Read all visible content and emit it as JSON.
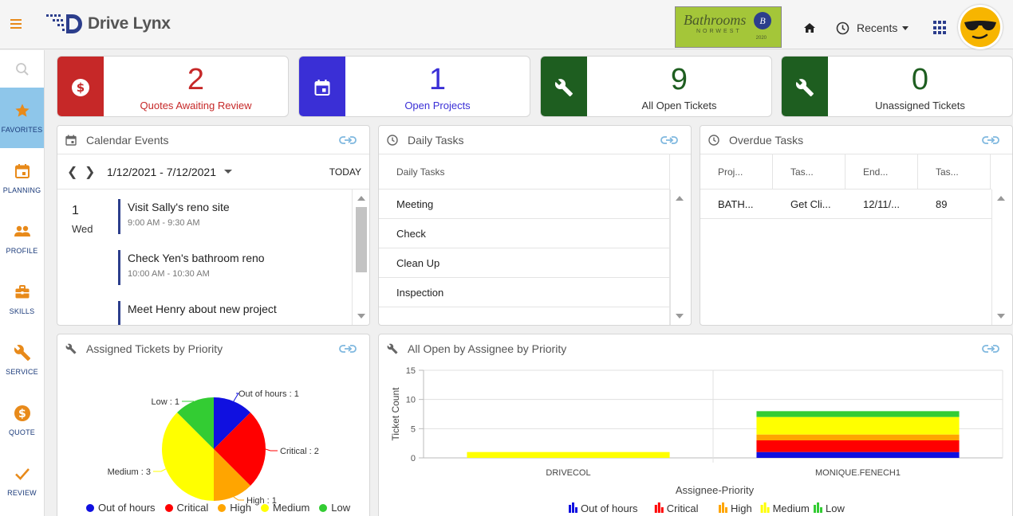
{
  "app": {
    "name": "Drive Lynx"
  },
  "brand": {
    "title": "Bathrooms",
    "subtitle": "NORWEST",
    "year": "2020",
    "mark": "B"
  },
  "header": {
    "recents_label": "Recents"
  },
  "sidebar": {
    "items": [
      {
        "label": "FAVORITES",
        "icon": "star-icon",
        "active": true
      },
      {
        "label": "PLANNING",
        "icon": "calendar-icon"
      },
      {
        "label": "PROFILE",
        "icon": "people-icon"
      },
      {
        "label": "SKILLS",
        "icon": "briefcase-icon"
      },
      {
        "label": "SERVICE",
        "icon": "wrench-icon"
      },
      {
        "label": "QUOTE",
        "icon": "dollar-icon"
      },
      {
        "label": "REVIEW",
        "icon": "check-icon"
      }
    ]
  },
  "kpis": [
    {
      "value": "2",
      "label": "Quotes Awaiting Review",
      "color": "#c62828",
      "icon": "dollar-icon"
    },
    {
      "value": "1",
      "label": "Open Projects",
      "color": "#3a2fd6",
      "icon": "calendar-icon"
    },
    {
      "value": "9",
      "label": "All Open Tickets",
      "color": "#1e5e20",
      "icon": "wrench-icon"
    },
    {
      "value": "0",
      "label": "Unassigned Tickets",
      "color": "#1e5e20",
      "icon": "wrench-icon"
    }
  ],
  "calendar": {
    "title": "Calendar Events",
    "range": "1/12/2021 - 7/12/2021",
    "today_label": "TODAY",
    "day_number": "1",
    "day_name": "Wed",
    "events": [
      {
        "title": "Visit Sally's reno site",
        "time": "9:00 AM - 9:30 AM"
      },
      {
        "title": "Check Yen's bathroom reno",
        "time": "10:00 AM - 10:30 AM"
      },
      {
        "title": "Meet Henry about new project",
        "time": ""
      }
    ]
  },
  "daily_tasks": {
    "title": "Daily Tasks",
    "column": "Daily Tasks",
    "rows": [
      "Meeting",
      "Check",
      "Clean Up",
      "Inspection"
    ]
  },
  "overdue_tasks": {
    "title": "Overdue Tasks",
    "columns": [
      "Proj...",
      "Tas...",
      "End...",
      "Tas..."
    ],
    "rows": [
      [
        "BATH...",
        "Get Cli...",
        "12/11/...",
        "89"
      ]
    ]
  },
  "chart_data": [
    {
      "type": "pie",
      "title": "Assigned Tickets by Priority",
      "categories": [
        "Out of hours",
        "Critical",
        "High",
        "Medium",
        "Low"
      ],
      "values": [
        1,
        2,
        1,
        3,
        1
      ],
      "data_labels": [
        "Out of hours : 1",
        "Critical : 2",
        "High : 1",
        "Medium : 3",
        "Low : 1"
      ],
      "colors": [
        "#1010e0",
        "#ff0000",
        "#ffa500",
        "#ffff00",
        "#33cc33"
      ],
      "legend": "bottom"
    },
    {
      "type": "bar",
      "stacked": true,
      "title": "All Open by Assignee by Priority",
      "categories": [
        "DRIVECOL",
        "MONIQUE.FENECH1"
      ],
      "xlabel": "Assignee-Priority",
      "ylabel": "Ticket Count",
      "ylim": [
        0,
        15
      ],
      "yticks": [
        "0",
        "5",
        "10",
        "15"
      ],
      "grid": true,
      "series": [
        {
          "name": "Out of hours",
          "color": "#1010e0",
          "values": [
            0,
            1
          ]
        },
        {
          "name": "Critical",
          "color": "#ff0000",
          "values": [
            0,
            2
          ]
        },
        {
          "name": "High",
          "color": "#ffa500",
          "values": [
            0,
            1
          ]
        },
        {
          "name": "Medium",
          "color": "#ffff00",
          "values": [
            1,
            3
          ]
        },
        {
          "name": "Low",
          "color": "#33cc33",
          "values": [
            0,
            1
          ]
        }
      ],
      "legend": "bottom"
    }
  ]
}
